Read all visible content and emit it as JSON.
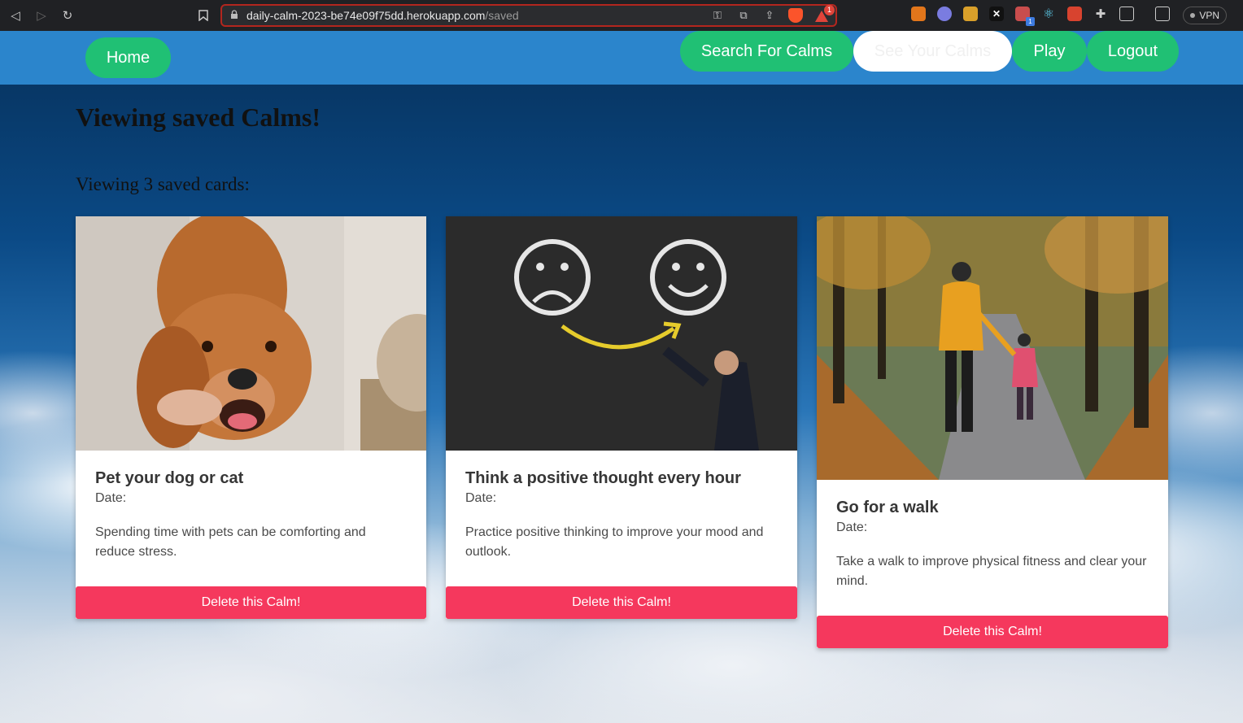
{
  "browser": {
    "url_host": "daily-calm-2023-be74e09f75dd.herokuapp.com",
    "url_path": "/saved",
    "alert_count": "1",
    "vpn_label": "VPN",
    "ext_badge": "1"
  },
  "nav": {
    "home": "Home",
    "search": "Search For Calms",
    "see": "See Your Calms",
    "play": "Play",
    "logout": "Logout"
  },
  "page": {
    "heading": "Viewing saved Calms!",
    "count_text": "Viewing 3 saved cards:"
  },
  "cards": [
    {
      "title": "Pet your dog or cat",
      "date_label": "Date:",
      "description": "Spending time with pets can be comforting and reduce stress.",
      "button": "Delete this Calm!"
    },
    {
      "title": "Think a positive thought every hour",
      "date_label": "Date:",
      "description": "Practice positive thinking to improve your mood and outlook.",
      "button": "Delete this Calm!"
    },
    {
      "title": "Go for a walk",
      "date_label": "Date:",
      "description": "Take a walk to improve physical fitness and clear your mind.",
      "button": "Delete this Calm!"
    }
  ],
  "colors": {
    "navbar": "#2b85cc",
    "pill": "#20c074",
    "delete": "#f5385d"
  }
}
